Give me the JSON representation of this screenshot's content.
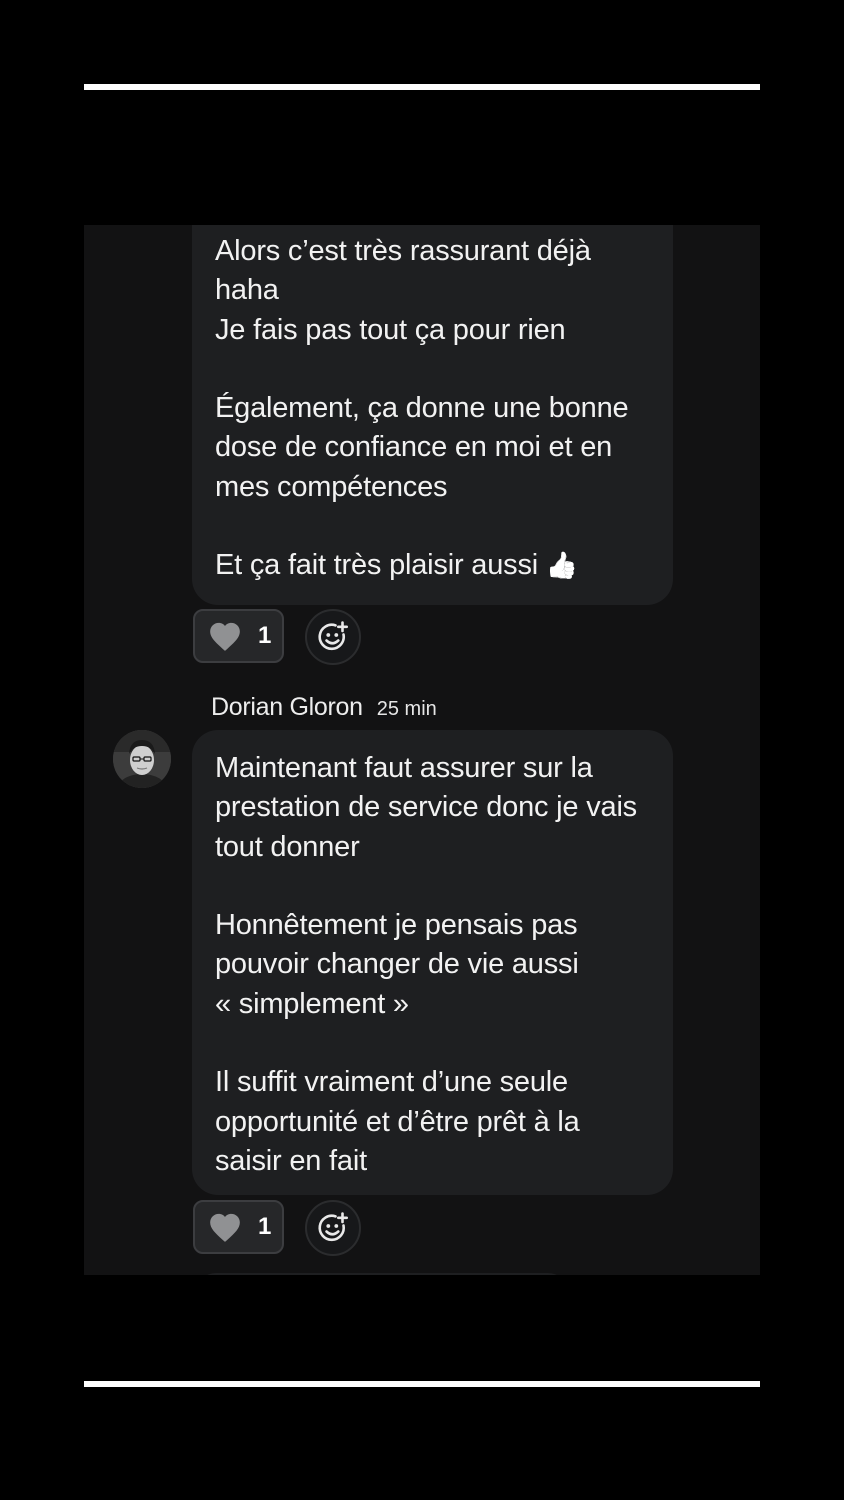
{
  "messages": [
    {
      "text": "Alors c’est très rassurant déjà\nhaha\nJe fais pas tout ça pour rien\n\nÉgalement, ça donne une bonne\ndose de confiance en moi et en\nmes compétences\n\nEt ça fait très plaisir aussi ",
      "emoji": "👍",
      "reaction": {
        "icon": "heart-icon",
        "count": "1"
      }
    },
    {
      "author": "Dorian Gloron",
      "time": "25 min",
      "text": "Maintenant faut assurer sur la\nprestation de service donc je vais\ntout donner\n\nHonnêtement je pensais pas\npouvoir changer de vie aussi\n« simplement »\n\nIl suffit vraiment d’une seule\nopportunité et d’être prêt à la\nsaisir en fait",
      "reaction": {
        "icon": "heart-icon",
        "count": "1"
      }
    }
  ],
  "colors": {
    "background": "#000000",
    "panel": "#121213",
    "bubble": "#1e1f21",
    "text": "#f2f2f2"
  }
}
